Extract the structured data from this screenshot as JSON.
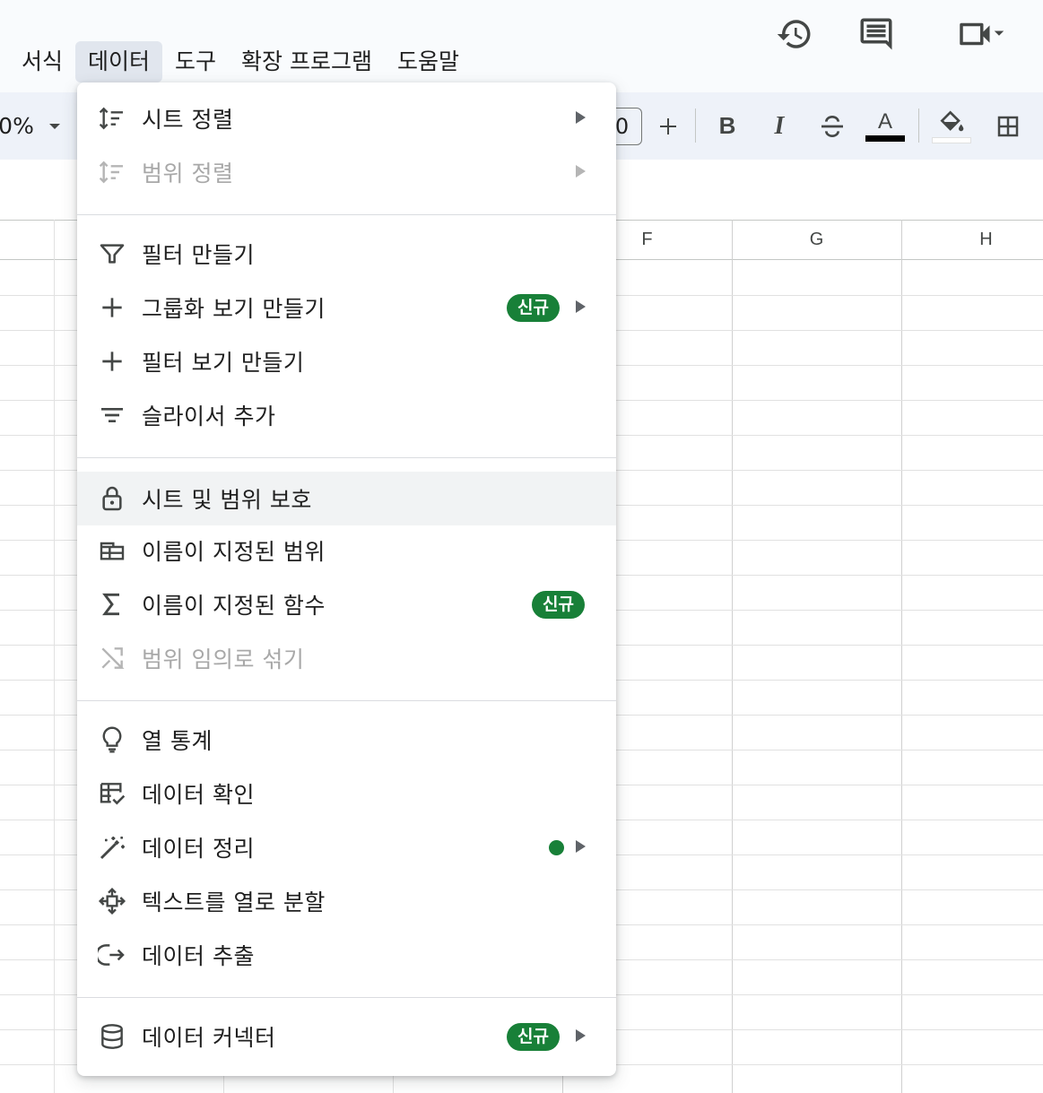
{
  "menubar": {
    "items": [
      "서식",
      "데이터",
      "도구",
      "확장 프로그램",
      "도움말"
    ],
    "active_index": 1
  },
  "header_icons": [
    "version-history-icon",
    "comment-icon",
    "meet-video-icon"
  ],
  "toolbar": {
    "zoom_fragment": "0%",
    "font_size_fragment": "0",
    "icons": [
      "plus-icon",
      "bold-icon",
      "italic-icon",
      "strikethrough-icon",
      "text-color-icon",
      "fill-color-icon",
      "borders-icon"
    ],
    "bold_label": "B",
    "italic_label": "I",
    "text_color_label": "A",
    "text_color": "#000000",
    "fill_color": "#ffffff"
  },
  "grid": {
    "columns": [
      "F",
      "G",
      "H"
    ]
  },
  "data_menu": {
    "items": [
      {
        "label": "시트 정렬",
        "icon": "sort-icon",
        "submenu": true,
        "disabled": false
      },
      {
        "label": "범위 정렬",
        "icon": "sort-range-icon",
        "submenu": true,
        "disabled": true
      },
      {
        "label": "필터 만들기",
        "icon": "filter-icon",
        "submenu": false,
        "disabled": false
      },
      {
        "label": "그룹화 보기 만들기",
        "icon": "plus-icon",
        "submenu": true,
        "disabled": false,
        "badge": "신규"
      },
      {
        "label": "필터 보기 만들기",
        "icon": "plus-icon",
        "submenu": false,
        "disabled": false
      },
      {
        "label": "슬라이서 추가",
        "icon": "slicer-icon",
        "submenu": false,
        "disabled": false
      },
      {
        "label": "시트 및 범위 보호",
        "icon": "lock-icon",
        "submenu": false,
        "disabled": false,
        "hovered": true
      },
      {
        "label": "이름이 지정된 범위",
        "icon": "named-range-icon",
        "submenu": false,
        "disabled": false
      },
      {
        "label": "이름이 지정된 함수",
        "icon": "sigma-icon",
        "submenu": false,
        "disabled": false,
        "badge": "신규"
      },
      {
        "label": "범위 임의로 섞기",
        "icon": "shuffle-icon",
        "submenu": false,
        "disabled": true
      },
      {
        "label": "열 통계",
        "icon": "lightbulb-icon",
        "submenu": false,
        "disabled": false
      },
      {
        "label": "데이터 확인",
        "icon": "data-validation-icon",
        "submenu": false,
        "disabled": false
      },
      {
        "label": "데이터 정리",
        "icon": "magic-wand-icon",
        "submenu": true,
        "disabled": false,
        "dot": true
      },
      {
        "label": "텍스트를 열로 분할",
        "icon": "split-icon",
        "submenu": false,
        "disabled": false
      },
      {
        "label": "데이터 추출",
        "icon": "extract-icon",
        "submenu": false,
        "disabled": false
      },
      {
        "label": "데이터 커넥터",
        "icon": "database-icon",
        "submenu": true,
        "disabled": false,
        "badge": "신규"
      }
    ],
    "colors": {
      "badge": "#188038",
      "hover": "#f1f3f4"
    }
  }
}
